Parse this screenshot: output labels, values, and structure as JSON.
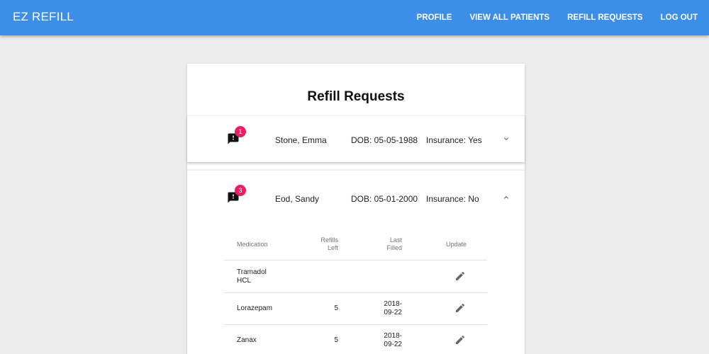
{
  "app": {
    "title": "EZ REFILL"
  },
  "nav": {
    "items": [
      "PROFILE",
      "VIEW ALL PATIENTS",
      "REFILL REQUESTS",
      "LOG OUT"
    ]
  },
  "page": {
    "title": "Refill Requests"
  },
  "patients": [
    {
      "badge": "1",
      "name": "Stone, Emma",
      "dob": "DOB: 05-05-1988",
      "insurance": "Insurance: Yes",
      "expanded": false
    },
    {
      "badge": "3",
      "name": "Eod, Sandy",
      "dob": "DOB: 05-01-2000",
      "insurance": "Insurance: No",
      "expanded": true
    }
  ],
  "table": {
    "headers": {
      "medication": "Medication",
      "refills_1": "Refills",
      "refills_2": "Left",
      "filled_1": "Last",
      "filled_2": "Filled",
      "update": "Update"
    },
    "rows": [
      {
        "med_1": "Tramadol",
        "med_2": "HCL",
        "refills": "",
        "filled_1": "",
        "filled_2": ""
      },
      {
        "med_1": "Lorazepam",
        "med_2": "",
        "refills": "5",
        "filled_1": "2018-",
        "filled_2": "09-22"
      },
      {
        "med_1": "Zanax",
        "med_2": "",
        "refills": "5",
        "filled_1": "2018-",
        "filled_2": "09-22"
      }
    ]
  },
  "icons": {
    "alert": "feedback-icon",
    "collapse": "chevron-down-icon",
    "expand": "chevron-up-icon",
    "edit": "pencil-icon"
  },
  "colors": {
    "appbar": "#3d8ee8",
    "badge": "#ea1f63",
    "background": "#ececec"
  }
}
